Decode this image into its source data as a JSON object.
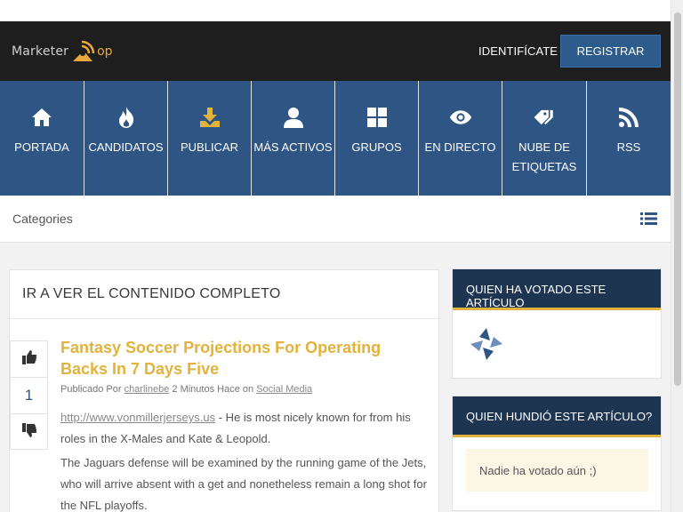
{
  "header": {
    "logo_part1": "Marketer",
    "logo_part2": "op",
    "login_label": "IDENTIFÍCATE",
    "register_label": "REGISTRAR"
  },
  "nav": {
    "items": [
      {
        "label": "PORTADA",
        "icon": "home-icon"
      },
      {
        "label": "CANDIDATOS",
        "icon": "fire-icon"
      },
      {
        "label": "PUBLICAR",
        "icon": "download-icon"
      },
      {
        "label": "MÁS ACTIVOS",
        "icon": "user-icon"
      },
      {
        "label": "GRUPOS",
        "icon": "grid-icon"
      },
      {
        "label": "EN DIRECTO",
        "icon": "eye-icon"
      },
      {
        "label": "NUBE DE ETIQUETAS",
        "icon": "tags-icon"
      },
      {
        "label": "RSS",
        "icon": "rss-icon"
      }
    ]
  },
  "categories": {
    "label": "Categories"
  },
  "main": {
    "heading": "IR A VER EL CONTENIDO COMPLETO",
    "vote_count": "1",
    "title": "Fantasy Soccer Projections For Operating Backs In 7 Days Five",
    "meta_prefix": "Publicado Por",
    "author": "charlinebe",
    "meta_time": "2 Minutos Hace",
    "meta_on": "on",
    "category": "Social Media",
    "body_link": "http://www.vonmillerjerseys.us",
    "body_p1": " - He is most nicely known for from his roles in the X-Males and Kate & Leopold.",
    "body_p2": "The Jaguars defense will be examined by the running game of the Jets, who will arrive absent with a get and nonetheless remain a long shot for the NFL playoffs."
  },
  "sidebar": {
    "voted_heading": "QUIEN HA VOTADO ESTE ARTÍCULO",
    "sunk_heading": "QUIEN HUNDIÓ ESTE ARTÍCULO?",
    "nobody_text": "Nadie ha votado aún ;)"
  },
  "colors": {
    "nav_bg": "#2f5585",
    "header_bg": "#1e1e1e",
    "accent": "#e2b33c",
    "side_head_bg": "#1e3552"
  }
}
